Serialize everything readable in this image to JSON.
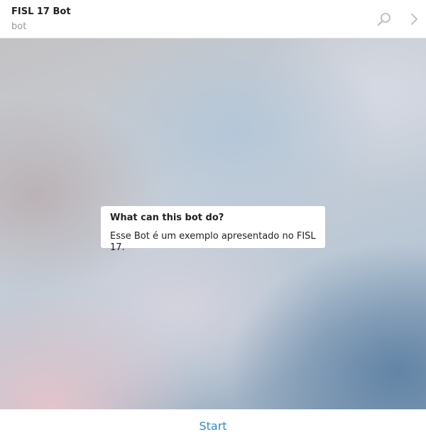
{
  "header": {
    "title": "FISL 17 Bot",
    "status": "bot",
    "icons": [
      "search-icon",
      "chevron-right-icon"
    ]
  },
  "bot_info": {
    "title": "What can this bot do?",
    "description": "Esse Bot é um exemplo apresentado no FISL 17."
  },
  "footer": {
    "start_label": "Start"
  },
  "colors": {
    "accent": "#2f8cc9",
    "icon": "#c2c2c2"
  }
}
